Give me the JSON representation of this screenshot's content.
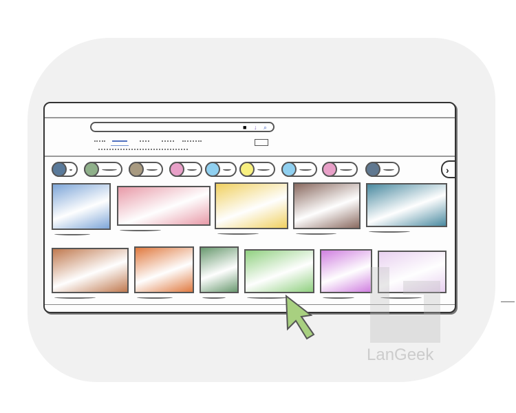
{
  "watermark": {
    "text": "LanGeek"
  },
  "search": {
    "icons": [
      "camera-icon",
      "microphone-icon",
      "search-icon"
    ]
  },
  "chips": {
    "colors": [
      "#5a7a9a",
      "#8fb08a",
      "#a89a80",
      "#e8a0c8",
      "#90d0f0",
      "#f8f080",
      "#90d0f0",
      "#e8a0c8",
      "#607890"
    ]
  },
  "thumbnails": {
    "row1": [
      "#7ea6d8",
      "#e89aa8",
      "#f0d060",
      "#8a6a60",
      "#4a8aa0"
    ],
    "row2": [
      "#c07a50",
      "#e07a40",
      "#6a9a70",
      "#90d080",
      "#d080e0",
      "#e8d0f0"
    ]
  },
  "cursor": {
    "color": "#a8d080"
  }
}
